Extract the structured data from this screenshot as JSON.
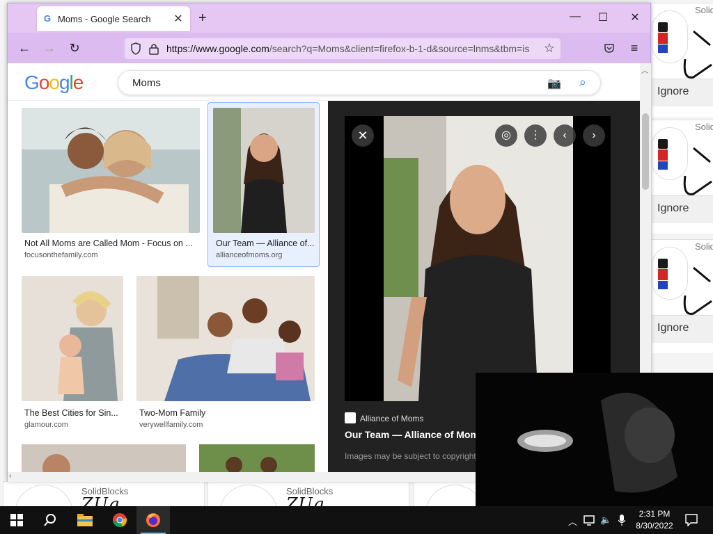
{
  "background_app": {
    "side_cards": [
      {
        "name": "Solid",
        "ignore": "Ignore"
      },
      {
        "name": "Solid",
        "ignore": "Ignore"
      },
      {
        "name": "Solid",
        "ignore": "Ignore"
      }
    ],
    "bottom_cards": [
      {
        "name": "SolidBlocks",
        "tag": "ZUg"
      },
      {
        "name": "SolidBlocks",
        "tag": "ZUg"
      },
      {
        "name": "",
        "tag": ""
      }
    ]
  },
  "browser": {
    "tab": {
      "title": "Moms - Google Search",
      "favicon": "G"
    },
    "url_domain": "https://www.google.com",
    "url_rest": "/search?q=Moms&client=firefox-b-1-d&source=lnms&tbm=is",
    "theme_colors": {
      "titlebar": "#e6c6f3",
      "navbar": "#dcbbf0"
    }
  },
  "google": {
    "logo_letters": [
      {
        "ch": "G",
        "color": "#4285f4"
      },
      {
        "ch": "o",
        "color": "#ea4335"
      },
      {
        "ch": "o",
        "color": "#fbbc05"
      },
      {
        "ch": "g",
        "color": "#4285f4"
      },
      {
        "ch": "l",
        "color": "#34a853"
      },
      {
        "ch": "e",
        "color": "#ea4335"
      }
    ],
    "query": "Moms"
  },
  "results": [
    {
      "caption": "Not All Moms are Called Mom - Focus on ...",
      "source": "focusonthefamily.com"
    },
    {
      "caption": "Our Team — Alliance of...",
      "source": "allianceofmoms.org"
    },
    {
      "caption": "The Best Cities for Sin...",
      "source": "glamour.com"
    },
    {
      "caption": "Two-Mom Family",
      "source": "verywellfamily.com"
    }
  ],
  "preview": {
    "site": "Alliance of Moms",
    "title": "Our Team — Alliance of Moms",
    "note": "Images may be subject to copyright."
  },
  "taskbar": {
    "time": "2:31 PM",
    "date": "8/30/2022"
  }
}
